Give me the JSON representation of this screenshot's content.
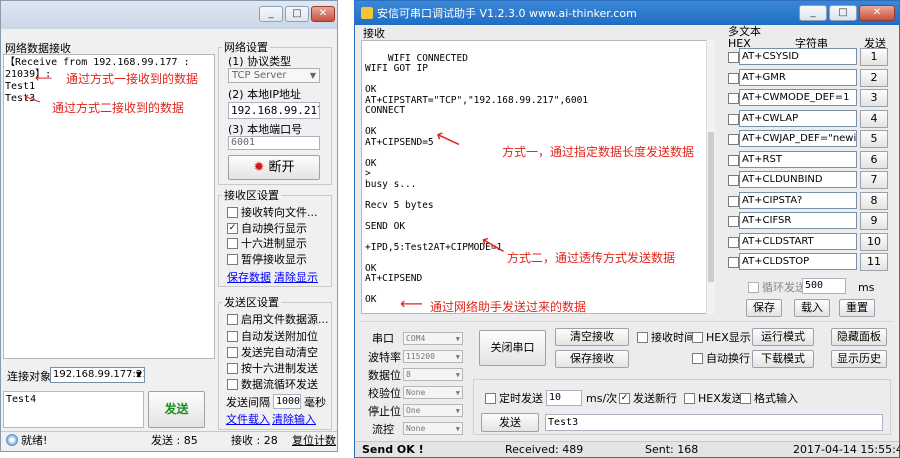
{
  "left": {
    "recv_group_title": "网络数据接收",
    "recv_lines": [
      "【Receive from 192.168.99.177 : 21039】:",
      "Test1",
      "Test3"
    ],
    "settings_title": "网络设置",
    "proto_label": "(1) 协议类型",
    "proto_value": "TCP Server",
    "ip_label": "(2) 本地IP地址",
    "ip_value": "192.168.99.217",
    "port_label": "(3) 本地端口号",
    "port_value": "6001",
    "disconnect_label": "断开",
    "recv_settings_title": "接收区设置",
    "recv_options": [
      {
        "label": "接收转向文件...",
        "checked": false
      },
      {
        "label": "自动换行显示",
        "checked": true
      },
      {
        "label": "十六进制显示",
        "checked": false
      },
      {
        "label": "暂停接收显示",
        "checked": false
      }
    ],
    "save_data_link": "保存数据",
    "clear_display_link": "清除显示",
    "send_settings_title": "发送区设置",
    "send_options": [
      {
        "label": "启用文件数据源...",
        "checked": false
      },
      {
        "label": "自动发送附加位",
        "checked": false
      },
      {
        "label": "发送完自动清空",
        "checked": false
      },
      {
        "label": "按十六进制发送",
        "checked": false
      },
      {
        "label": "数据流循环发送",
        "checked": false
      }
    ],
    "interval_label": "发送间隔",
    "interval_value": "1000",
    "interval_unit": "毫秒",
    "file_load_link": "文件载入",
    "clear_input_link": "清除输入",
    "target_label": "连接对象:",
    "target_value": "192.168.99.177:210",
    "send_text": "Test4",
    "send_button": "发送",
    "status_ready": "就绪!",
    "status_sent": "发送 : 85",
    "status_recv": "接收 : 28",
    "reset_count": "复位计数",
    "anno1": "通过方式一接收到的数据",
    "anno2": "通过方式二接收到的数据"
  },
  "right": {
    "title": "安信可串口调试助手 V1.2.3.0    www.ai-thinker.com",
    "recv_label": "接收",
    "recv_text": "WIFI CONNECTED\nWIFI GOT IP\n\nOK\nAT+CIPSTART=\"TCP\",\"192.168.99.217\",6001\nCONNECT\n\nOK\nAT+CIPSEND=5\n\nOK\n>\nbusy s...\n\nRecv 5 bytes\n\nSEND OK\n\n+IPD,5:Test2AT+CIPMODE=1\n\nOK\nAT+CIPSEND\n\nOK\n\n>Test4",
    "anno_mode1": "方式一，通过指定数据长度发送数据",
    "anno_mode2": "方式二，通过透传方式发送数据",
    "anno_test4": "通过网络助手发送过来的数据",
    "multi_title": "多文本",
    "col_hex": "HEX",
    "col_string": "字符串",
    "col_send": "发送",
    "multi_rows": [
      {
        "text": "AT+CSYSID",
        "num": "1"
      },
      {
        "text": "AT+GMR",
        "num": "2"
      },
      {
        "text": "AT+CWMODE_DEF=1",
        "num": "3"
      },
      {
        "text": "AT+CWLAP",
        "num": "4"
      },
      {
        "text": "AT+CWJAP_DEF=\"newifi_",
        "num": "5"
      },
      {
        "text": "AT+RST",
        "num": "6"
      },
      {
        "text": "AT+CLDUNBIND",
        "num": "7"
      },
      {
        "text": "AT+CIPSTA?",
        "num": "8"
      },
      {
        "text": "AT+CIFSR",
        "num": "9"
      },
      {
        "text": "AT+CLDSTART",
        "num": "10"
      },
      {
        "text": "AT+CLDSTOP",
        "num": "11"
      }
    ],
    "loop_label": "循环发送",
    "loop_value": "500",
    "loop_unit": "ms",
    "save_btn": "保存",
    "load_btn": "载入",
    "reset_btn": "重置",
    "port_fields": [
      {
        "label": "串口",
        "value": "COM4"
      },
      {
        "label": "波特率",
        "value": "115200"
      },
      {
        "label": "数据位",
        "value": "8"
      },
      {
        "label": "校验位",
        "value": "None"
      },
      {
        "label": "停止位",
        "value": "One"
      },
      {
        "label": "流控",
        "value": "None"
      }
    ],
    "close_port_btn": "关闭串口",
    "clear_recv_btn": "清空接收",
    "save_recv_btn": "保存接收",
    "recv_time_label": "接收时间",
    "hex_display_label": "HEX显示",
    "run_mode_btn": "运行模式",
    "hide_panel_btn": "隐藏面板",
    "auto_wrap_label": "自动换行",
    "download_mode_btn": "下载模式",
    "show_history_btn": "显示历史",
    "timed_send_label": "定时发送",
    "timed_value": "10",
    "timed_unit": "ms/次",
    "send_newline_label": "发送新行",
    "hex_send_label": "HEX发送",
    "format_input_label": "格式输入",
    "send_btn": "发送",
    "send_text": "Test3",
    "status_send_ok": "Send OK !",
    "status_received": "Received: 489",
    "status_sent": "Sent: 168",
    "status_time": "2017-04-14 15:55:41"
  },
  "colors": {
    "accent_red": "#e0261c",
    "link_blue": "#0000ff",
    "titlebar_right": "#1f6fc5"
  }
}
